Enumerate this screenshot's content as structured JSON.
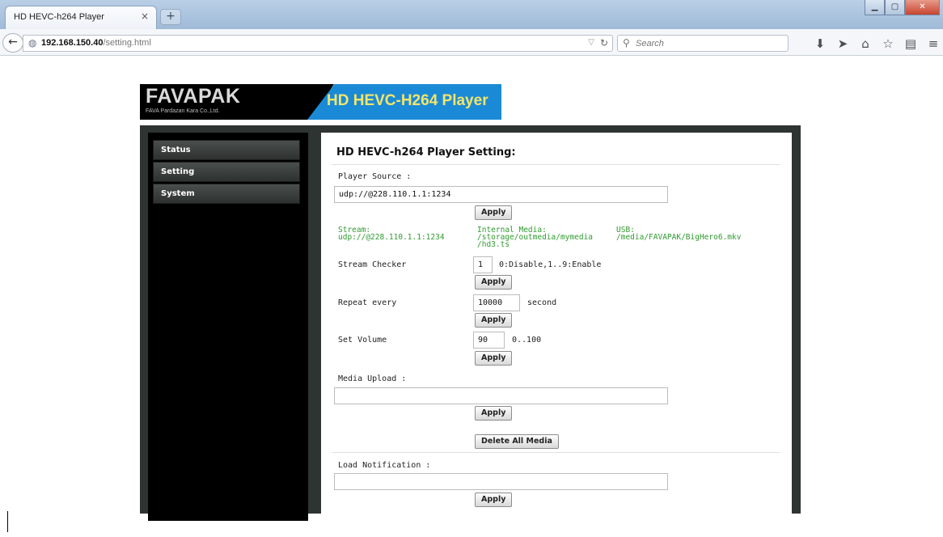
{
  "browser": {
    "tab_title": "HD HEVC-h264 Player",
    "tab_close": "×",
    "new_tab": "+",
    "url_host": "192.168.150.40",
    "url_path": "/setting.html",
    "search_placeholder": "Search",
    "icons": [
      "download-icon",
      "send-icon",
      "home-icon",
      "bookmark-star-icon",
      "reader-icon",
      "menu-icon"
    ]
  },
  "banner": {
    "logo": "FAVAPAK",
    "logo_sub": "FAVA Pardazan Kara Co.,Ltd.",
    "title": "HD HEVC-H264 Player",
    "colors": {
      "left": "#000000",
      "right": "#1b8ad6",
      "title": "#f3e56a"
    }
  },
  "sidebar": {
    "items": [
      {
        "label": "Status"
      },
      {
        "label": "Setting"
      },
      {
        "label": "System"
      }
    ]
  },
  "settings": {
    "title": "HD HEVC-h264 Player Setting:",
    "player_source": {
      "label": "Player Source :",
      "value": "udp://@228.110.1.1:1234",
      "apply": "Apply"
    },
    "sources": {
      "stream_label": "Stream:",
      "stream_value": "udp://@228.110.1.1:1234",
      "internal_label": "Internal Media:",
      "internal_value_1": "/storage/outmedia/mymedia",
      "internal_value_2": "/hd3.ts",
      "usb_label": "USB:",
      "usb_value": "/media/FAVAPAK/BigHero6.mkv"
    },
    "stream_checker": {
      "label": "Stream Checker",
      "value": "1",
      "hint": "0:Disable,1..9:Enable",
      "apply": "Apply"
    },
    "repeat_every": {
      "label": "Repeat every",
      "value": "10000",
      "unit": "second",
      "apply": "Apply"
    },
    "set_volume": {
      "label": "Set Volume",
      "value": "90",
      "range": "0..100",
      "apply": "Apply"
    },
    "media_upload": {
      "label": "Media Upload :",
      "value": "",
      "apply": "Apply",
      "delete_all": "Delete All Media"
    },
    "load_notification": {
      "label": "Load Notification :",
      "value": "",
      "apply": "Apply"
    }
  }
}
